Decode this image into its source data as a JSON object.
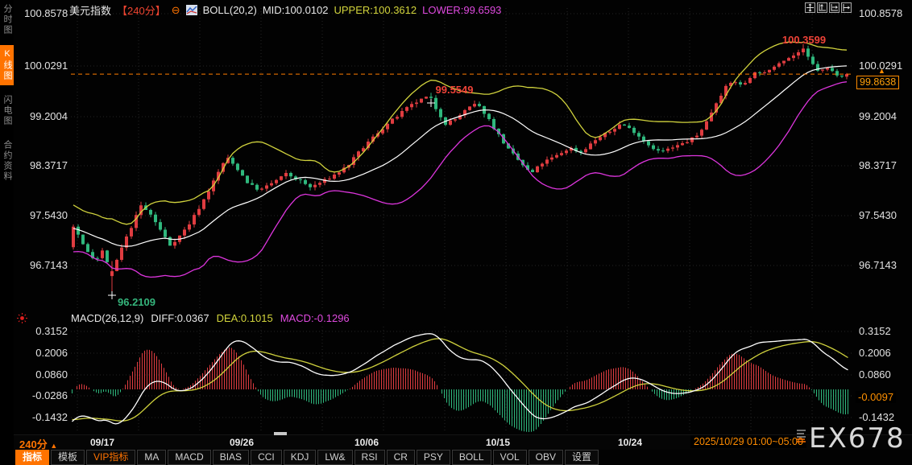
{
  "header": {
    "symbol": "美元指数",
    "period": "【240分】",
    "boll_label": "BOLL(20,2)",
    "mid": "MID:100.0102",
    "upper": "UPPER:100.3612",
    "lower": "LOWER:99.6593"
  },
  "icons": {
    "collapse": "⊖",
    "up_arrow": "▲"
  },
  "sidebar": {
    "tabs": [
      {
        "label": "分时图",
        "active": false
      },
      {
        "label": "K线图",
        "active": true
      },
      {
        "label": "闪电图",
        "active": false
      },
      {
        "label": "合约资料",
        "active": false
      }
    ]
  },
  "macd_header": {
    "label": "MACD(26,12,9)",
    "diff": "DIFF:0.0367",
    "dea": "DEA:0.1015",
    "macd": "MACD:-0.1296"
  },
  "badges": {
    "price": "99.8638",
    "macd": "-0.0097"
  },
  "bottom": {
    "period": "240分",
    "date_range": "2025/10/29 01:00~05:00"
  },
  "watermark": {
    "text": "EX678"
  },
  "toolbar": {
    "items": [
      {
        "label": "指标",
        "active": true
      },
      {
        "label": "模板"
      },
      {
        "label": "VIP指标",
        "vip": true
      },
      {
        "label": "MA"
      },
      {
        "label": "MACD"
      },
      {
        "label": "BIAS"
      },
      {
        "label": "CCI"
      },
      {
        "label": "KDJ"
      },
      {
        "label": "LW&"
      },
      {
        "label": "RSI"
      },
      {
        "label": "CR"
      },
      {
        "label": "PSY"
      },
      {
        "label": "BOLL"
      },
      {
        "label": "VOL"
      },
      {
        "label": "OBV"
      },
      {
        "label": "设置"
      }
    ]
  },
  "chart_data": {
    "type": "candlestick",
    "title": "美元指数 240分",
    "indicators": {
      "boll": {
        "params": "20,2",
        "mid": 100.0102,
        "upper": 100.3612,
        "lower": 99.6593
      },
      "macd": {
        "params": "26,12,9",
        "diff": 0.0367,
        "dea": 0.1015,
        "macd": -0.1296,
        "last_axis_value": -0.0097
      }
    },
    "last_price": 99.8638,
    "key_points": {
      "high": 100.3599,
      "swing_high": 99.5549,
      "low": 96.2109
    },
    "annotations": {
      "high": "100.3599",
      "swing_high": "99.5549",
      "low": "96.2109"
    },
    "y_axis_main": {
      "labels": [
        "100.8578",
        "100.0291",
        "99.2004",
        "98.3717",
        "97.5430",
        "96.7143"
      ]
    },
    "y_axis_macd": {
      "labels": [
        "0.3152",
        "0.2006",
        "0.0860",
        "-0.0286",
        "-0.1432"
      ]
    },
    "x_axis": {
      "labels": [
        "09/17",
        "09/26",
        "10/06",
        "10/15",
        "10/24"
      ]
    },
    "price_path": [
      [
        91,
        97.35
      ],
      [
        105,
        97.0
      ],
      [
        119,
        96.8
      ],
      [
        127,
        96.95
      ],
      [
        139,
        96.6
      ],
      [
        151,
        97.0
      ],
      [
        163,
        97.35
      ],
      [
        175,
        97.7
      ],
      [
        187,
        97.55
      ],
      [
        199,
        97.3
      ],
      [
        211,
        97.05
      ],
      [
        223,
        97.2
      ],
      [
        235,
        97.4
      ],
      [
        251,
        97.75
      ],
      [
        265,
        98.1
      ],
      [
        281,
        98.5
      ],
      [
        295,
        98.3
      ],
      [
        309,
        98.05
      ],
      [
        323,
        97.95
      ],
      [
        341,
        98.1
      ],
      [
        355,
        98.22
      ],
      [
        371,
        98.12
      ],
      [
        385,
        98.0
      ],
      [
        401,
        98.1
      ],
      [
        417,
        98.22
      ],
      [
        431,
        98.35
      ],
      [
        447,
        98.6
      ],
      [
        461,
        98.8
      ],
      [
        477,
        99.0
      ],
      [
        491,
        99.15
      ],
      [
        505,
        99.3
      ],
      [
        519,
        99.42
      ],
      [
        533,
        99.5
      ],
      [
        541,
        99.3
      ],
      [
        553,
        99.05
      ],
      [
        565,
        99.12
      ],
      [
        579,
        99.28
      ],
      [
        591,
        99.38
      ],
      [
        603,
        99.2
      ],
      [
        617,
        98.9
      ],
      [
        631,
        98.62
      ],
      [
        645,
        98.42
      ],
      [
        659,
        98.22
      ],
      [
        673,
        98.4
      ],
      [
        691,
        98.52
      ],
      [
        707,
        98.65
      ],
      [
        721,
        98.58
      ],
      [
        739,
        98.78
      ],
      [
        757,
        98.92
      ],
      [
        771,
        99.05
      ],
      [
        787,
        98.92
      ],
      [
        803,
        98.72
      ],
      [
        819,
        98.58
      ],
      [
        835,
        98.65
      ],
      [
        851,
        98.74
      ],
      [
        865,
        98.85
      ],
      [
        877,
        99.08
      ],
      [
        889,
        99.4
      ],
      [
        899,
        99.62
      ],
      [
        911,
        99.76
      ],
      [
        921,
        99.66
      ],
      [
        931,
        99.82
      ],
      [
        941,
        99.92
      ],
      [
        951,
        99.86
      ],
      [
        961,
        100.0
      ],
      [
        971,
        100.1
      ],
      [
        981,
        100.14
      ],
      [
        991,
        100.22
      ],
      [
        997,
        100.26
      ],
      [
        1007,
        100.05
      ],
      [
        1017,
        99.9
      ],
      [
        1027,
        99.96
      ],
      [
        1037,
        99.87
      ],
      [
        1047,
        99.84
      ],
      [
        1053,
        99.8638
      ]
    ],
    "colors": {
      "up": "#e03c40",
      "down": "#2fb87d",
      "boll_upper": "#d0d23d",
      "boll_mid": "#ffffff",
      "boll_lower": "#dd35dd",
      "price_line": "#ff7d00",
      "accent": "#ff7300"
    }
  }
}
